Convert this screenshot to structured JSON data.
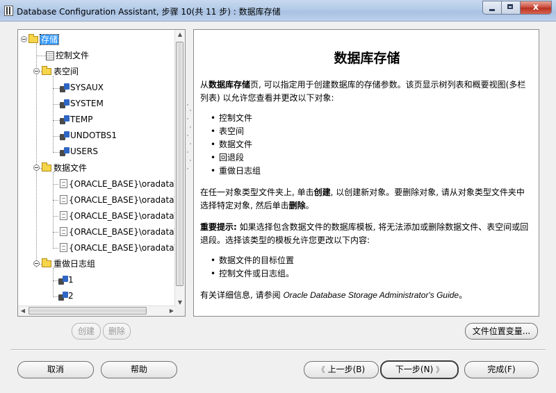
{
  "window": {
    "title": "Database Configuration Assistant, 步骤 10(共 11 步) : 数据库存储",
    "close_glyph": "x"
  },
  "tree": {
    "root": "存储",
    "control_files": "控制文件",
    "tablespaces": {
      "label": "表空间",
      "items": [
        "SYSAUX",
        "SYSTEM",
        "TEMP",
        "UNDOTBS1",
        "USERS"
      ]
    },
    "datafiles": {
      "label": "数据文件",
      "items": [
        "{ORACLE_BASE}\\oradata\\",
        "{ORACLE_BASE}\\oradata\\",
        "{ORACLE_BASE}\\oradata\\",
        "{ORACLE_BASE}\\oradata\\",
        "{ORACLE_BASE}\\oradata\\"
      ]
    },
    "redo_logs": {
      "label": "重做日志组",
      "items": [
        "1",
        "2"
      ]
    }
  },
  "tree_buttons": {
    "create": "创建",
    "delete": "删除"
  },
  "info": {
    "title": "数据库存储",
    "p1_a": "从",
    "p1_b": "数据库存储",
    "p1_c": "页, 可以指定用于创建数据库的存储参数。该页显示树列表和概要视图(多栏列表) 以允许您查看并更改以下对象:",
    "list1": [
      "控制文件",
      "表空间",
      "数据文件",
      "回退段",
      "重做日志组"
    ],
    "p2_a": "在任一对象类型文件夹上, 单击",
    "p2_b": "创建",
    "p2_c": ", 以创建新对象。要删除对象, 请从对象类型文件夹中选择特定对象, 然后单击",
    "p2_d": "删除",
    "p2_e": "。",
    "p3_a": "重要提示:",
    "p3_b": " 如果选择包含数据文件的数据库模板, 将无法添加或删除数据文件、表空间或回退段。选择该类型的模板允许您更改以下内容:",
    "list2": [
      "数据文件的目标位置",
      "控制文件或日志组。"
    ],
    "p4_a": "有关详细信息, 请参阅 ",
    "p4_b": "Oracle Database Storage Administrator's Guide",
    "p4_c": "。"
  },
  "buttons": {
    "file_location_vars": "文件位置变量...",
    "cancel": "取消",
    "help": "帮助",
    "back": "上一步(B)",
    "next": "下一步(N)",
    "finish": "完成(F)"
  }
}
